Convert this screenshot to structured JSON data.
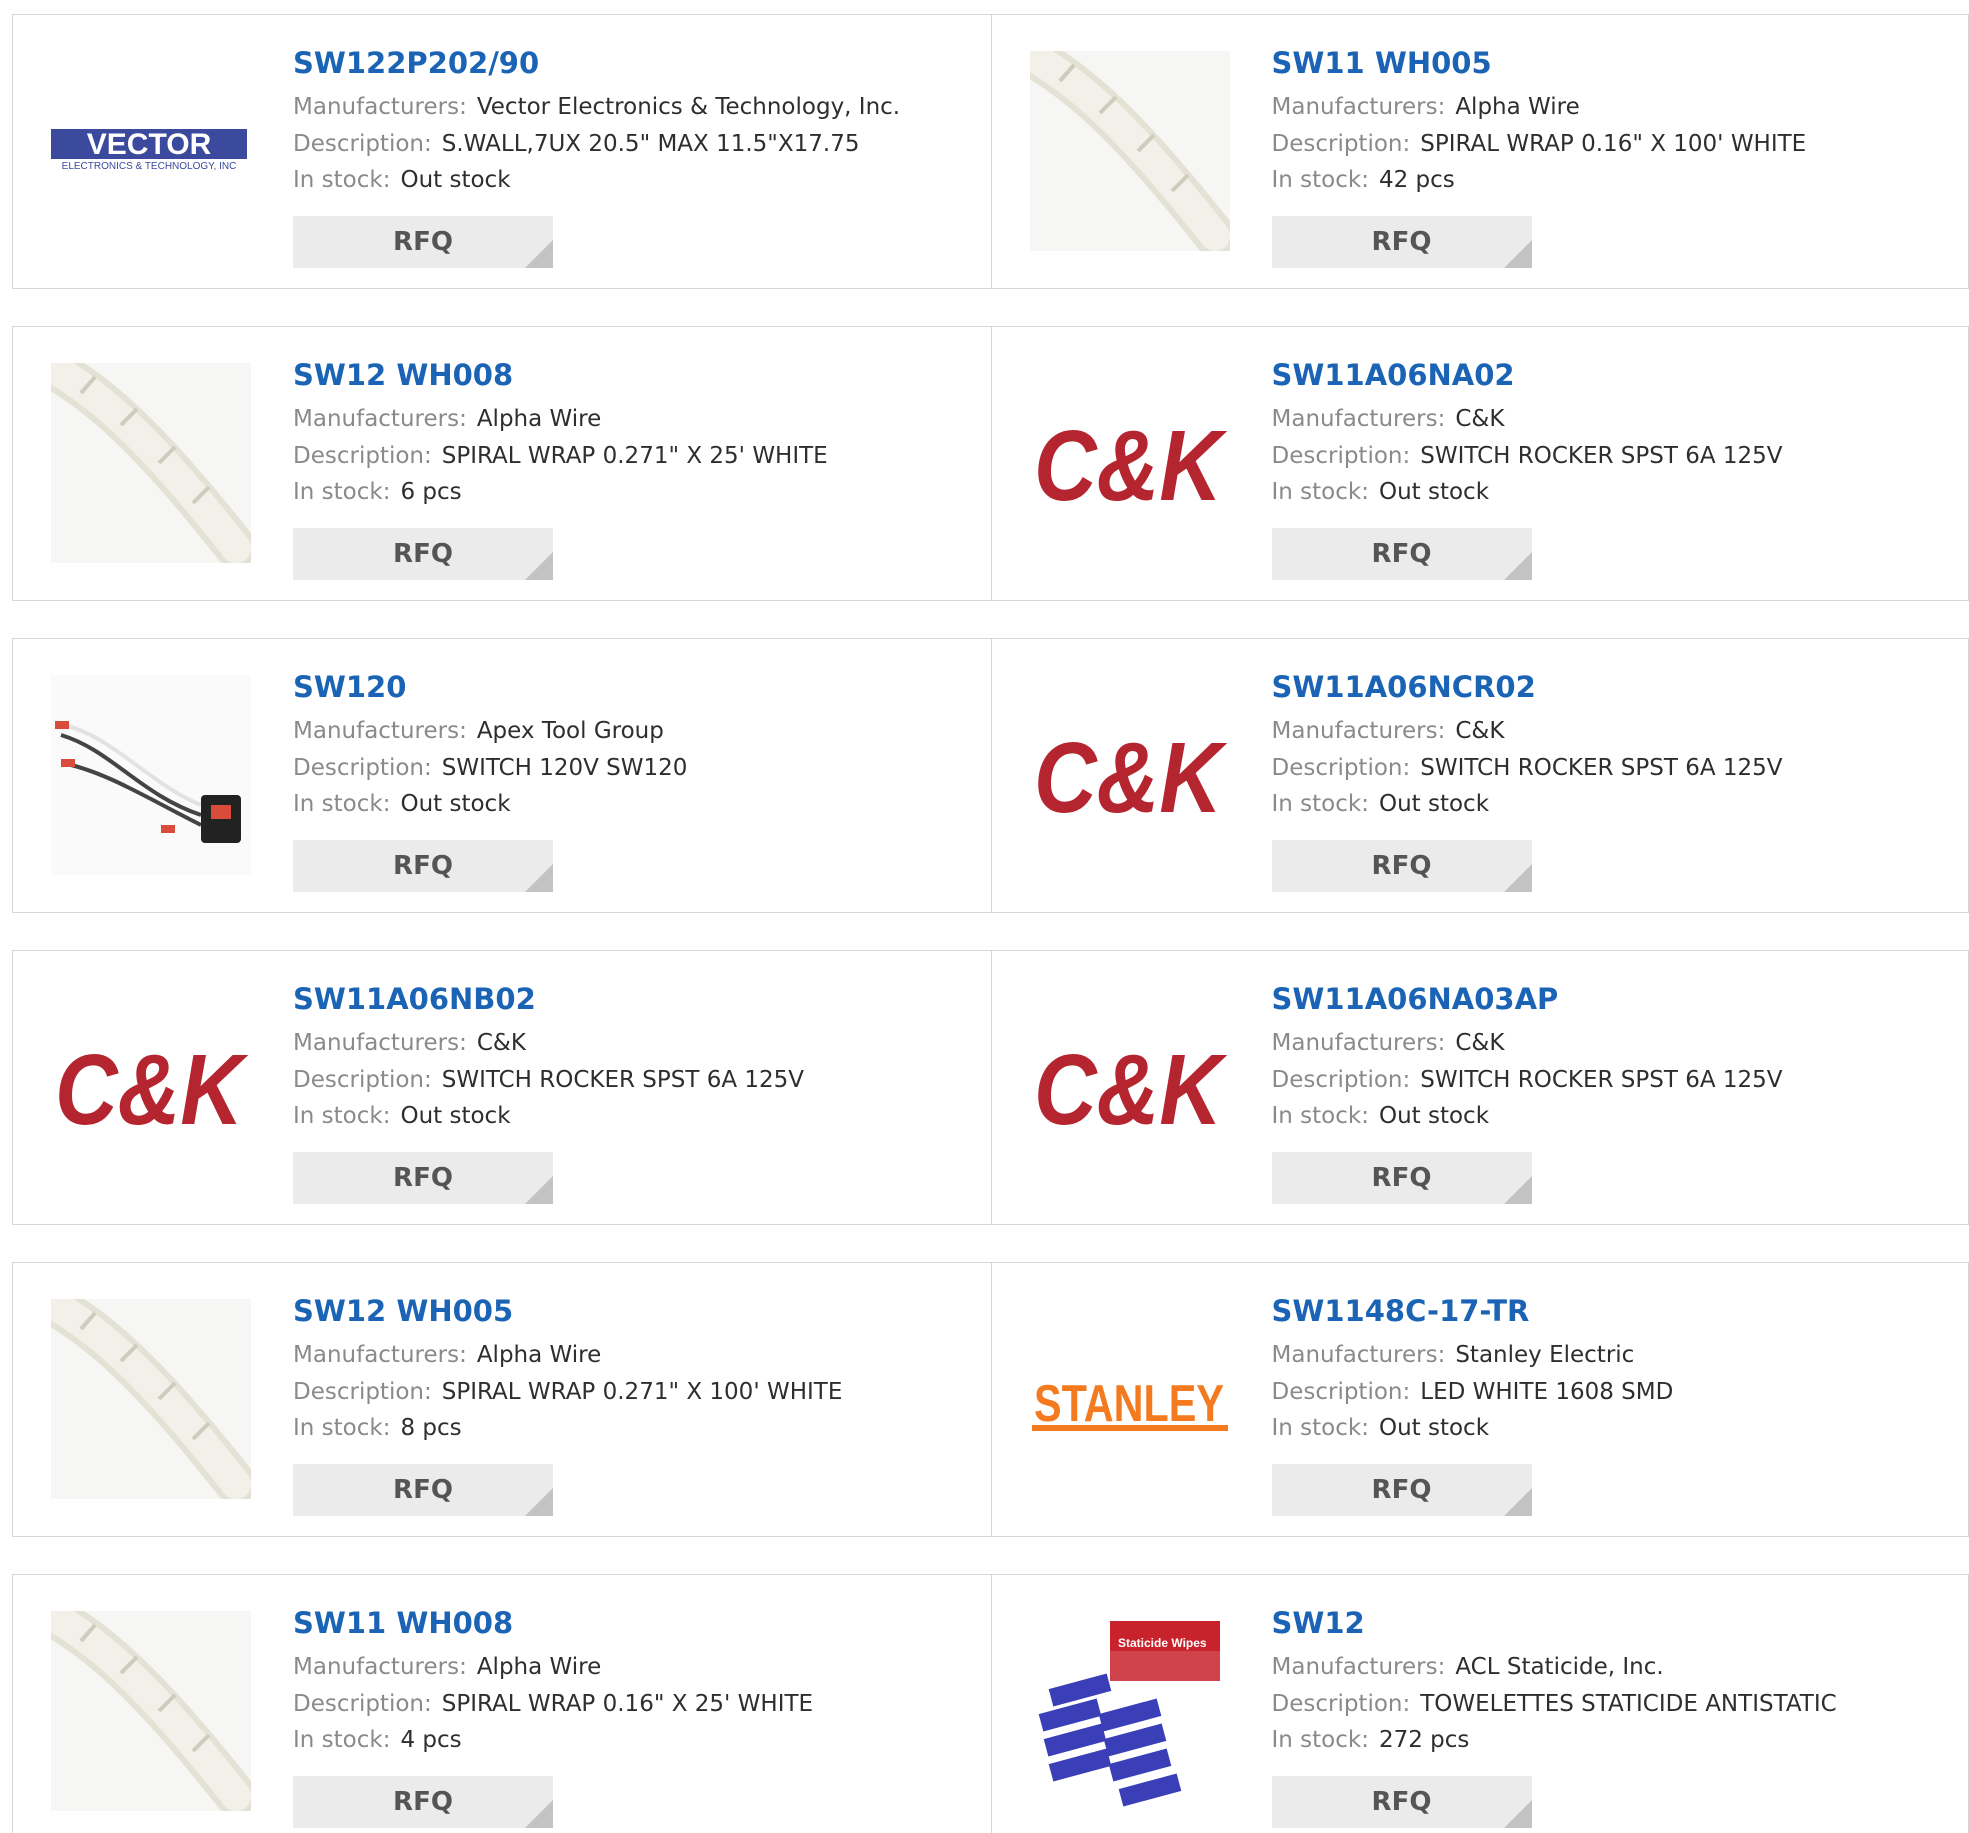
{
  "labels": {
    "manufacturer": "Manufacturers:",
    "description": "Description:",
    "stock": "In stock:",
    "rfq": "RFQ"
  },
  "logos": {
    "vector_main": "VECTOR",
    "vector_sub": "ELECTRONICS & TECHNOLOGY, INC",
    "ck": "C&K",
    "stanley": "STANLEY",
    "staticide": "Staticide Wipes"
  },
  "products": [
    {
      "part": "SW122P202/90",
      "manufacturer": "Vector Electronics & Technology, Inc.",
      "description": "S.WALL,7UX 20.5\" MAX 11.5\"X17.75",
      "stock": "Out stock",
      "image": "vector-logo"
    },
    {
      "part": "SW11 WH005",
      "manufacturer": "Alpha Wire",
      "description": "SPIRAL WRAP 0.16\" X 100' WHITE",
      "stock": "42 pcs",
      "image": "spiral-wrap-photo"
    },
    {
      "part": "SW12 WH008",
      "manufacturer": "Alpha Wire",
      "description": "SPIRAL WRAP 0.271\" X 25' WHITE",
      "stock": "6 pcs",
      "image": "spiral-wrap-photo"
    },
    {
      "part": "SW11A06NA02",
      "manufacturer": "C&K",
      "description": "SWITCH ROCKER SPST 6A 125V",
      "stock": "Out stock",
      "image": "ck-logo"
    },
    {
      "part": "SW120",
      "manufacturer": "Apex Tool Group",
      "description": "SWITCH 120V SW120",
      "stock": "Out stock",
      "image": "switch-harness-photo"
    },
    {
      "part": "SW11A06NCR02",
      "manufacturer": "C&K",
      "description": "SWITCH ROCKER SPST 6A 125V",
      "stock": "Out stock",
      "image": "ck-logo"
    },
    {
      "part": "SW11A06NB02",
      "manufacturer": "C&K",
      "description": "SWITCH ROCKER SPST 6A 125V",
      "stock": "Out stock",
      "image": "ck-logo"
    },
    {
      "part": "SW11A06NA03AP",
      "manufacturer": "C&K",
      "description": "SWITCH ROCKER SPST 6A 125V",
      "stock": "Out stock",
      "image": "ck-logo"
    },
    {
      "part": "SW12 WH005",
      "manufacturer": "Alpha Wire",
      "description": "SPIRAL WRAP 0.271\" X 100' WHITE",
      "stock": "8 pcs",
      "image": "spiral-wrap-photo"
    },
    {
      "part": "SW1148C-17-TR",
      "manufacturer": "Stanley Electric",
      "description": "LED WHITE 1608 SMD",
      "stock": "Out stock",
      "image": "stanley-logo"
    },
    {
      "part": "SW11 WH008",
      "manufacturer": "Alpha Wire",
      "description": "SPIRAL WRAP 0.16\" X 25' WHITE",
      "stock": "4 pcs",
      "image": "spiral-wrap-photo"
    },
    {
      "part": "SW12",
      "manufacturer": "ACL Staticide, Inc.",
      "description": "TOWELETTES STATICIDE ANTISTATIC",
      "stock": "272 pcs",
      "image": "staticide-wipes-photo"
    }
  ],
  "colors": {
    "link": "#1b63b4",
    "label": "#8a8a8a",
    "value": "#2e2e2e",
    "button_bg": "#ebebeb",
    "border": "#d6d6d6",
    "ck_red": "#b5252f",
    "stanley_orange": "#f47a20",
    "vector_blue": "#3b4a9c"
  }
}
